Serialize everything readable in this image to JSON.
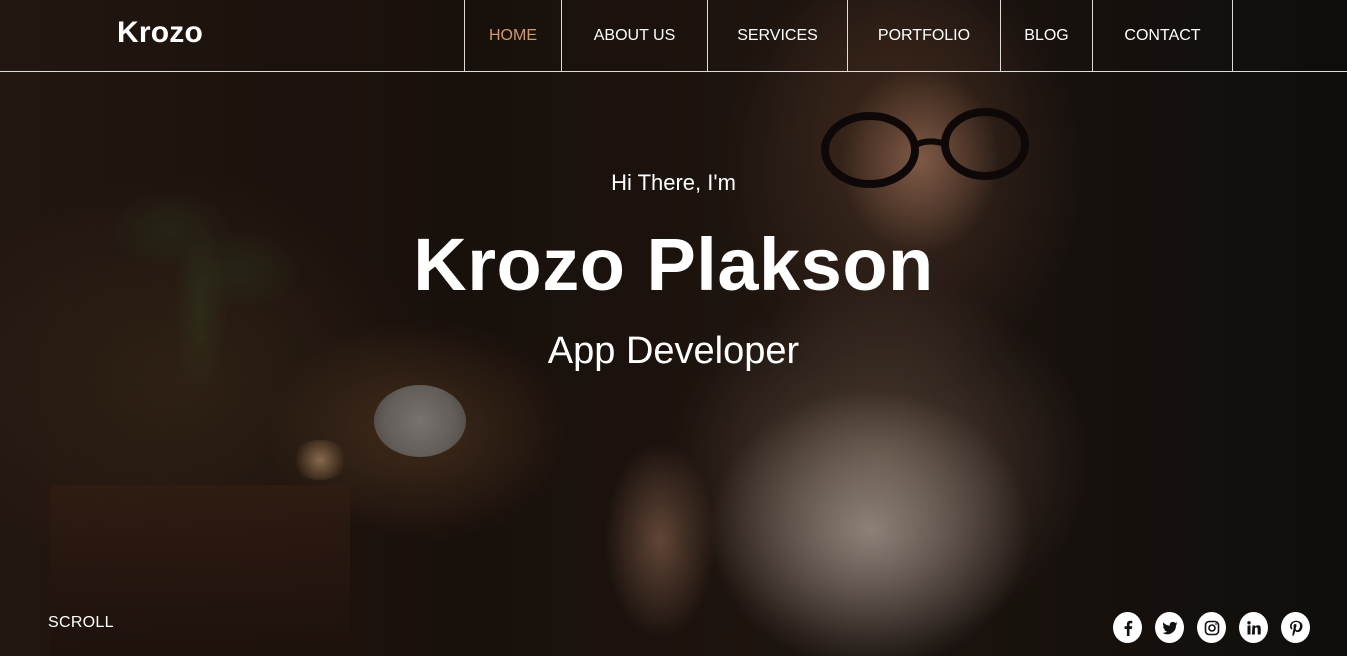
{
  "brand": {
    "logo": "Krozo"
  },
  "nav": {
    "items": [
      {
        "label": "HOME",
        "active": true
      },
      {
        "label": "ABOUT US",
        "active": false
      },
      {
        "label": "SERVICES",
        "active": false
      },
      {
        "label": "PORTFOLIO",
        "active": false
      },
      {
        "label": "BLOG",
        "active": false
      },
      {
        "label": "CONTACT",
        "active": false
      }
    ],
    "active_color": "#d29a6b"
  },
  "hero": {
    "intro": "Hi There, I'm",
    "name": "Krozo Plakson",
    "role": "App Developer"
  },
  "scroll_label": "SCROLL",
  "socials": [
    {
      "icon": "facebook-icon"
    },
    {
      "icon": "twitter-icon"
    },
    {
      "icon": "instagram-icon"
    },
    {
      "icon": "linkedin-icon"
    },
    {
      "icon": "pinterest-icon"
    }
  ]
}
